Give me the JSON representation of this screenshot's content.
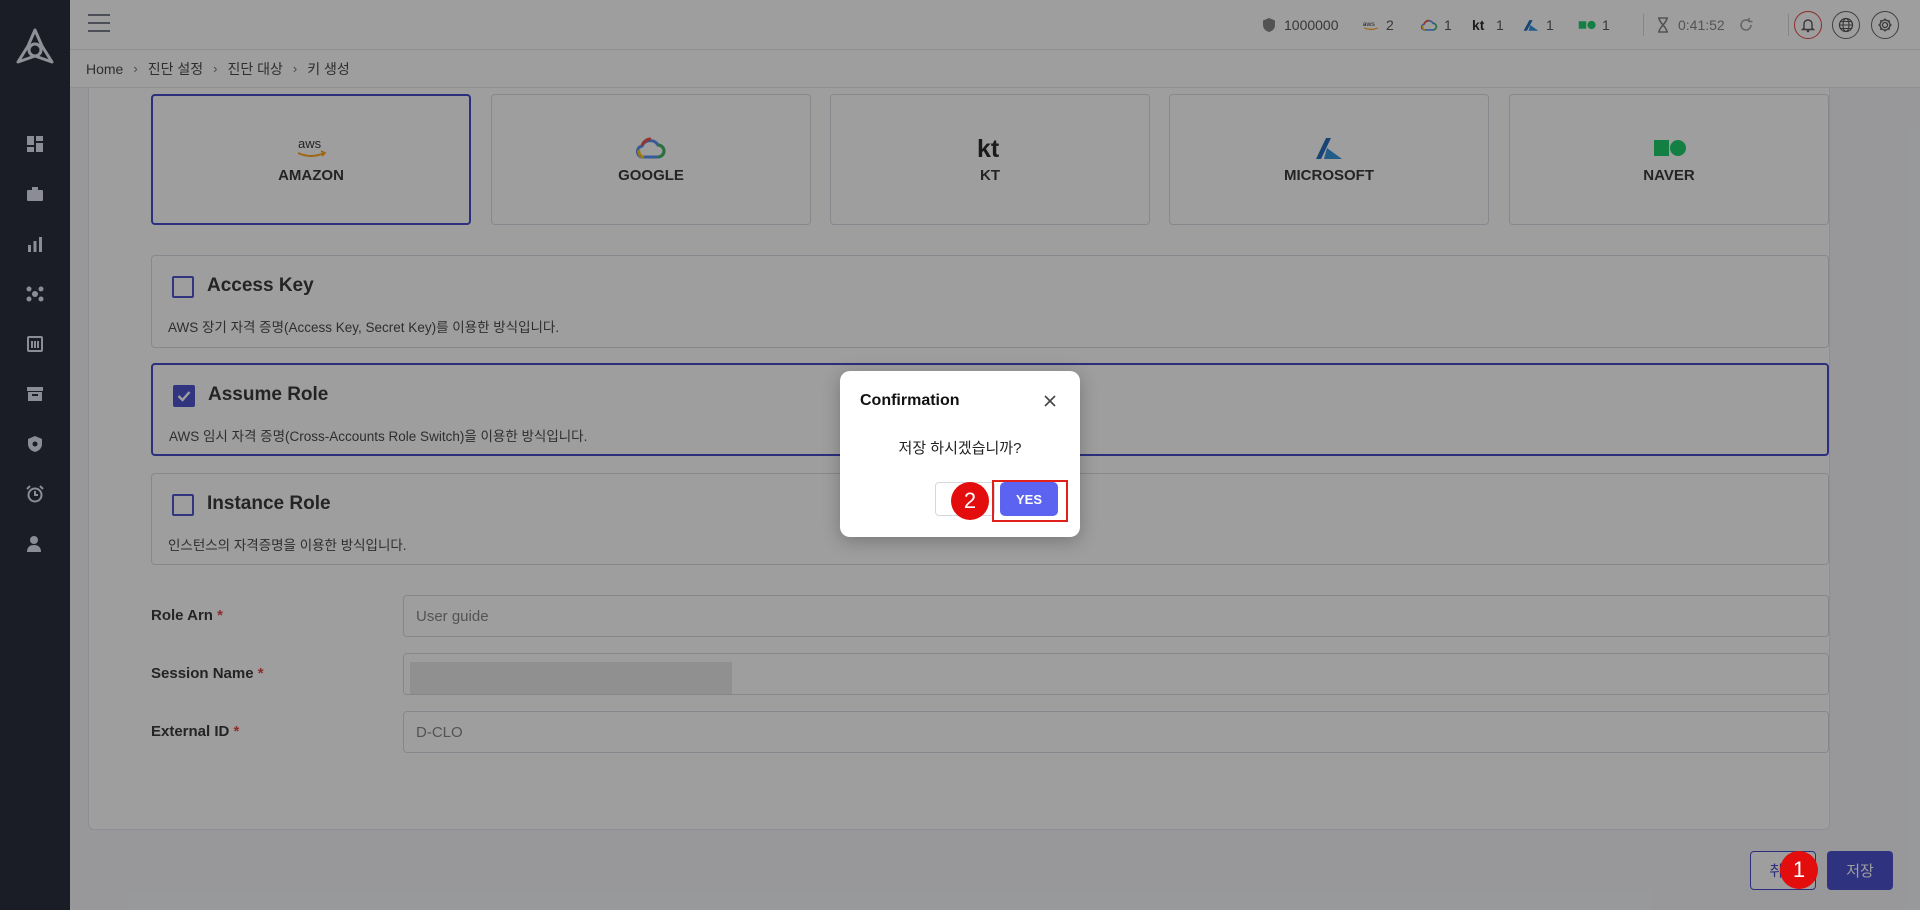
{
  "topbar": {
    "credits": "1000000",
    "counts": {
      "aws": "2",
      "gcp": "1",
      "kt": "1",
      "azure": "1",
      "naver": "1"
    },
    "timer": "0:41:52"
  },
  "breadcrumb": [
    "Home",
    "진단 설정",
    "진단 대상",
    "키 생성"
  ],
  "providers": [
    {
      "name": "AMAZON",
      "logo_text": "aws",
      "selected": true
    },
    {
      "name": "GOOGLE",
      "selected": false
    },
    {
      "name": "KT",
      "logo_text": "kt",
      "selected": false
    },
    {
      "name": "MICROSOFT",
      "selected": false
    },
    {
      "name": "NAVER",
      "selected": false
    }
  ],
  "methods": [
    {
      "title": "Access Key",
      "desc": "AWS 장기 자격 증명(Access Key, Secret Key)를 이용한 방식입니다.",
      "checked": false
    },
    {
      "title": "Assume Role",
      "desc": "AWS 임시 자격 증명(Cross-Accounts Role Switch)을 이용한 방식입니다.",
      "checked": true
    },
    {
      "title": "Instance Role",
      "desc": "인스턴스의 자격증명을 이용한 방식입니다.",
      "checked": false
    }
  ],
  "fields": {
    "role_arn": {
      "label": "Role Arn",
      "placeholder": "User guide"
    },
    "session_name": {
      "label": "Session Name",
      "value": ""
    },
    "external_id": {
      "label": "External ID",
      "placeholder": "D-CLO"
    },
    "required_mark": "*"
  },
  "actions": {
    "cancel": "취소",
    "save": "저장"
  },
  "dialog": {
    "title": "Confirmation",
    "message": "저장 하시겠습니까?",
    "no_label": "",
    "yes_label": "YES"
  },
  "annotations": {
    "step1": "1",
    "step2": "2"
  },
  "colors": {
    "primary": "#353dc7",
    "sidebar": "#101326",
    "yes_button": "#5b63f0",
    "annotation_red": "#e30d0d"
  }
}
